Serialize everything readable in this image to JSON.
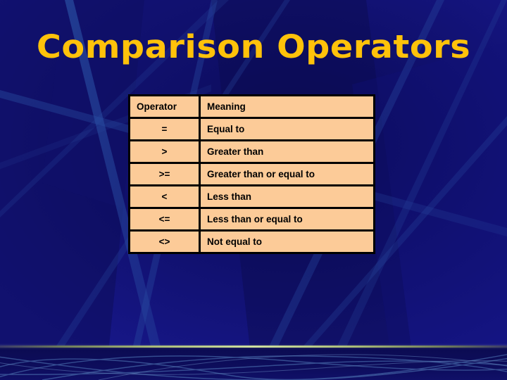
{
  "slide": {
    "title": "Comparison Operators",
    "title_color": "#FFC20A",
    "background_color": "#14148a",
    "accent_line_color": "#CFE0A0",
    "table_fill_color": "#FCCB98",
    "table_border_color": "#000000"
  },
  "table": {
    "headers": [
      "Operator",
      "Meaning"
    ],
    "rows": [
      {
        "operator": "=",
        "meaning": "Equal to"
      },
      {
        "operator": ">",
        "meaning": "Greater than"
      },
      {
        "operator": ">=",
        "meaning": "Greater than or equal to"
      },
      {
        "operator": "<",
        "meaning": "Less than"
      },
      {
        "operator": "<=",
        "meaning": "Less than or equal to"
      },
      {
        "operator": "<>",
        "meaning": "Not equal to"
      }
    ]
  }
}
